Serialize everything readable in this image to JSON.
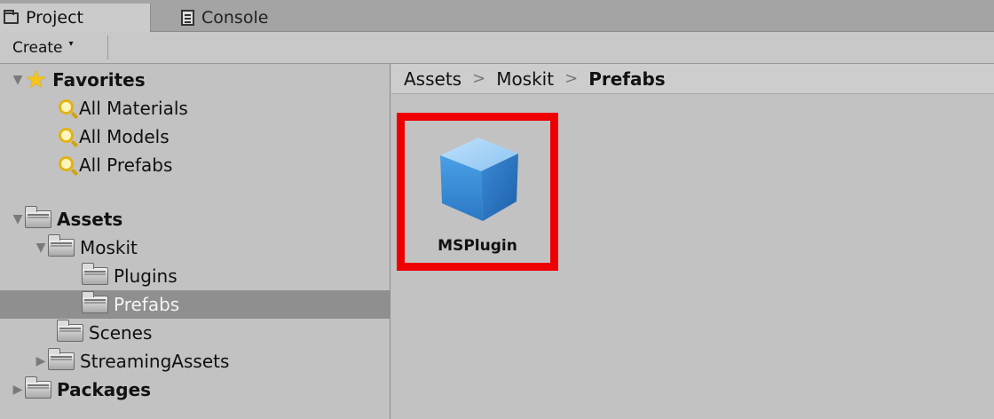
{
  "tabs": [
    {
      "label": "Project",
      "icon": "folder-icon",
      "active": true
    },
    {
      "label": "Console",
      "icon": "console-icon",
      "active": false
    }
  ],
  "toolbar": {
    "create_label": "Create",
    "create_caret": "▾"
  },
  "sidebar": {
    "favorites": {
      "label": "Favorites",
      "items": [
        {
          "label": "All Materials",
          "icon": "search-icon"
        },
        {
          "label": "All Models",
          "icon": "search-icon"
        },
        {
          "label": "All Prefabs",
          "icon": "search-icon"
        }
      ]
    },
    "assets": {
      "label": "Assets",
      "moskit": {
        "label": "Moskit",
        "children": [
          {
            "label": "Plugins"
          },
          {
            "label": "Prefabs",
            "selected": true
          }
        ]
      },
      "scenes": {
        "label": "Scenes"
      },
      "streaming": {
        "label": "StreamingAssets"
      }
    },
    "packages": {
      "label": "Packages"
    }
  },
  "breadcrumb": {
    "items": [
      "Assets",
      "Moskit",
      "Prefabs"
    ],
    "separator": ">"
  },
  "content": {
    "assets": [
      {
        "name": "MSPlugin",
        "type": "prefab",
        "icon": "cube-icon",
        "highlight_color": "#ee0000"
      }
    ]
  },
  "colors": {
    "selection": "#8f8f8f",
    "panel": "#c2c2c2",
    "highlight": "#ee0000",
    "star": "#f4c518"
  }
}
